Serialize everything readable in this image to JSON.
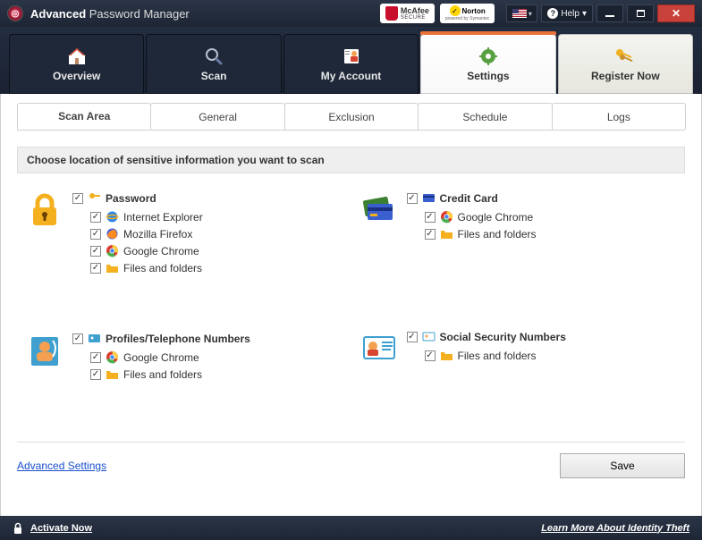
{
  "title": {
    "bold": "Advanced",
    "rest": "Password Manager"
  },
  "badges": {
    "mcafee": "McAfee",
    "mcafee_sub": "SECURE",
    "norton": "Norton",
    "norton_sub": "powered by Symantec"
  },
  "help_label": "Help",
  "nav": {
    "overview": "Overview",
    "scan": "Scan",
    "my_account": "My Account",
    "settings": "Settings",
    "register": "Register Now"
  },
  "subtabs": {
    "scan_area": "Scan Area",
    "general": "General",
    "exclusion": "Exclusion",
    "schedule": "Schedule",
    "logs": "Logs"
  },
  "section_header": "Choose location of sensitive information you want to scan",
  "groups": {
    "password": {
      "title": "Password",
      "items": [
        "Internet Explorer",
        "Mozilla Firefox",
        "Google Chrome",
        "Files and folders"
      ]
    },
    "credit_card": {
      "title": "Credit Card",
      "items": [
        "Google Chrome",
        "Files and folders"
      ]
    },
    "profiles": {
      "title": "Profiles/Telephone Numbers",
      "items": [
        "Google Chrome",
        "Files and folders"
      ]
    },
    "ssn": {
      "title": "Social Security Numbers",
      "items": [
        "Files and folders"
      ]
    }
  },
  "advanced_settings": "Advanced Settings",
  "save": "Save",
  "activate_now": "Activate Now",
  "learn_more": "Learn More About Identity Theft"
}
